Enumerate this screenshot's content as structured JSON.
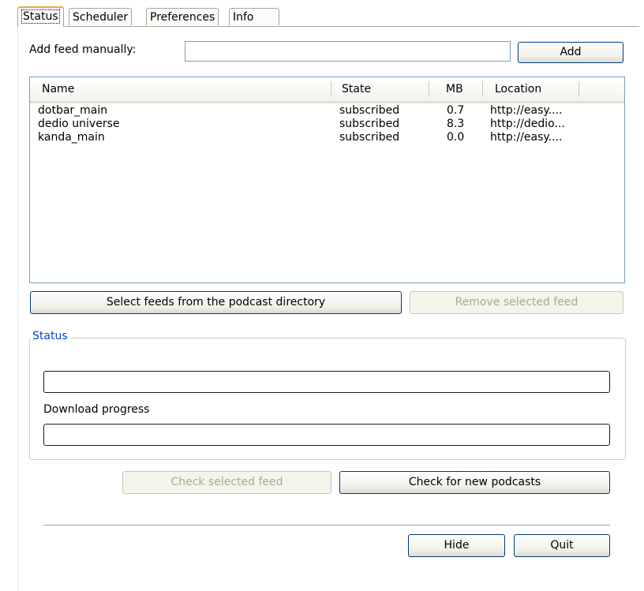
{
  "tabs": [
    {
      "label": "Status",
      "active": true
    },
    {
      "label": "Scheduler",
      "active": false
    },
    {
      "label": "Preferences",
      "active": false
    },
    {
      "label": "Info",
      "active": false
    }
  ],
  "add_feed": {
    "label": "Add feed manually:",
    "value": "",
    "button": "Add"
  },
  "feeds_table": {
    "columns": [
      "Name",
      "State",
      "MB",
      "Location"
    ],
    "rows": [
      {
        "name": "dotbar_main",
        "state": "subscribed",
        "mb": "0.7",
        "location": "http://easy...."
      },
      {
        "name": "dedio universe",
        "state": "subscribed",
        "mb": "8.3",
        "location": "http://dedio..."
      },
      {
        "name": "kanda_main",
        "state": "subscribed",
        "mb": "0.0",
        "location": "http://easy...."
      }
    ]
  },
  "feed_buttons": {
    "select": "Select feeds from the podcast directory",
    "remove": "Remove selected feed"
  },
  "status_group": {
    "title": "Status",
    "status_value": "",
    "download_label": "Download progress",
    "download_value": ""
  },
  "check_buttons": {
    "check_selected": "Check selected feed",
    "check_new": "Check for new podcasts"
  },
  "bottom_buttons": {
    "hide": "Hide",
    "quit": "Quit"
  },
  "colors": {
    "active_tab_accent": "#f2a93b",
    "group_title": "#0046d5",
    "button_border": "#003c74",
    "disabled_text": "#aca899"
  }
}
